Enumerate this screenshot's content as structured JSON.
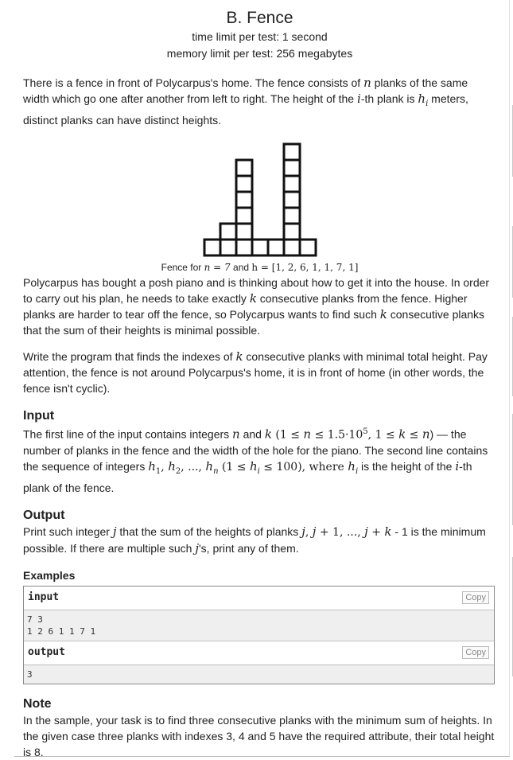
{
  "problem": {
    "title": "B. Fence",
    "time_limit": "time limit per test: 1 second",
    "memory_limit": "memory limit per test: 256 megabytes"
  },
  "statement": {
    "p1_a": "There is a fence in front of Polycarpus's home. The fence consists of ",
    "p1_n": "n",
    "p1_b": " planks of the same width which go one after another from left to right. The height of the ",
    "p1_i": "i",
    "p1_c": "-th plank is ",
    "p1_h": "h",
    "p1_hi": "i",
    "p1_d": " meters, distinct planks can have distinct heights.",
    "caption_a": "Fence for ",
    "caption_n": "n = 7",
    "caption_b": " and ",
    "caption_h": "h = [1, 2, 6, 1, 1, 7, 1]",
    "p2_a": "Polycarpus has bought a posh piano and is thinking about how to get it into the house. In order to carry out his plan, he needs to take exactly ",
    "p2_k": "k",
    "p2_b": " consecutive planks from the fence. Higher planks are harder to tear off the fence, so Polycarpus wants to find such ",
    "p2_k2": "k",
    "p2_c": " consecutive planks that the sum of their heights is minimal possible.",
    "p3_a": "Write the program that finds the indexes of ",
    "p3_k": "k",
    "p3_b": " consecutive planks with minimal total height. Pay attention, the fence is not around Polycarpus's home, it is in front of home (in other words, the fence isn't cyclic)."
  },
  "input_section": {
    "heading": "Input",
    "t_a": "The first line of the input contains integers ",
    "t_n": "n",
    "t_b": " and ",
    "t_k": "k",
    "t_c": " (1 ≤ ",
    "t_n2": "n",
    "t_d": " ≤ 1.5·10",
    "t_sup": "5",
    "t_e": ", 1 ≤ ",
    "t_k2": "k",
    "t_f": " ≤ ",
    "t_n3": "n",
    "t_g": ") — the number of planks in the fence and the width of the hole for the piano. The second line contains the sequence of integers ",
    "t_h": "h",
    "t_h1": "1",
    "t_h2": "2",
    "t_hn": "n",
    "t_sep1": ", ",
    "t_sep2": ", ..., ",
    "t_i": " (1 ≤ ",
    "t_hi": "h",
    "t_hii": "i",
    "t_j": " ≤ 100), where ",
    "t_hi2": "h",
    "t_hii2": "i",
    "t_k_": " is the height of the ",
    "t_ii": "i",
    "t_l": "-th plank of the fence."
  },
  "output_section": {
    "heading": "Output",
    "t_a": "Print such integer ",
    "t_j": "j",
    "t_b": " that the sum of the heights of planks ",
    "t_j2": "j",
    "t_c": ", ",
    "t_j3": "j",
    "t_d": " + 1, ..., ",
    "t_j4": "j",
    "t_e": " + ",
    "t_k": "k",
    "t_f": " - 1 is the minimum possible. If there are multiple such ",
    "t_j5": "j",
    "t_g": "'s, print any of them."
  },
  "examples": {
    "heading": "Examples",
    "input_label": "input",
    "output_label": "output",
    "copy_label": "Copy",
    "input_lines": [
      "7 3",
      "1 2 6 1 1 7 1"
    ],
    "output_lines": [
      "3"
    ]
  },
  "note": {
    "heading": "Note",
    "text": "In the sample, your task is to find three consecutive planks with the minimum sum of heights. In the given case three planks with indexes 3, 4 and 5 have the required attribute, their total height is 8."
  },
  "figure": {
    "heights": [
      1,
      2,
      6,
      1,
      1,
      7,
      1
    ]
  }
}
